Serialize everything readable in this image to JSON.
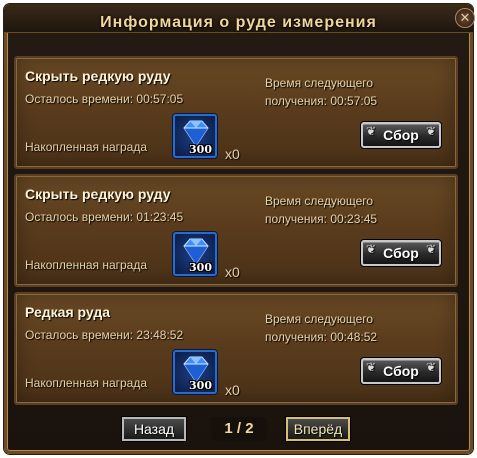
{
  "window": {
    "title": "Информация о руде измерения",
    "close_symbol": "✕"
  },
  "panels": [
    {
      "heading": "Скрыть редкую руду",
      "remaining": "Осталось времени: 00:57:05",
      "next_line1": "Время следующего",
      "next_line2": "получения: 00:57:05",
      "reward_label": "Накопленная награда",
      "gem_count": "300",
      "multiplier": "x0",
      "collect_label": "Сбор"
    },
    {
      "heading": "Скрыть редкую руду",
      "remaining": "Осталось времени: 01:23:45",
      "next_line1": "Время следующего",
      "next_line2": "получения: 00:23:45",
      "reward_label": "Накопленная награда",
      "gem_count": "300",
      "multiplier": "x0",
      "collect_label": "Сбор"
    },
    {
      "heading": "Редкая руда",
      "remaining": "Осталось времени: 23:48:52",
      "next_line1": "Время следующего",
      "next_line2": "получения: 00:48:52",
      "reward_label": "Накопленная награда",
      "gem_count": "300",
      "multiplier": "x0",
      "collect_label": "Сбор"
    }
  ],
  "pagination": {
    "back_label": "Назад",
    "page": "1 / 2",
    "forward_label": "Вперёд"
  },
  "colors": {
    "gem_border": "#2a6bd1",
    "title_gold": "#f2d79a",
    "panel_brown": "#5a3c1d"
  },
  "icons": {
    "gem": "blue-diamond-icon",
    "close": "close-icon"
  }
}
